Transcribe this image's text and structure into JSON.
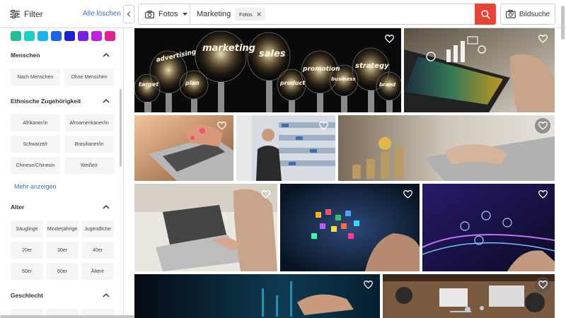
{
  "topbar": {
    "filter_label": "Filter",
    "clear_all_label": "Alle löschen",
    "type_select_value": "Fotos",
    "query_text": "Marketing",
    "chip_label": "Fotos",
    "image_search_label": "Bildsuche"
  },
  "sidebar": {
    "color_swatches": [
      "#1fbf9a",
      "#19d1c8",
      "#18b6f0",
      "#1f64e6",
      "#1b1fd8",
      "#7a1fe6",
      "#c01fe6",
      "#e61f8f"
    ],
    "people": {
      "title": "Menschen",
      "options": [
        "Nach Menschen",
        "Ohne Menschen"
      ]
    },
    "ethnicity": {
      "title": "Ethnische Zugehörigkeit",
      "options": [
        "Afrikaner/in",
        "Afroamerikaner/in",
        "Schwarze/r",
        "Brasilianer/in",
        "Chinese/Chinesin",
        "Weiße/r"
      ],
      "more_label": "Mehr anzeigen"
    },
    "age": {
      "title": "Alter",
      "options": [
        "Säuglinge",
        "Minderjährige",
        "Jugendliche",
        "20er",
        "30er",
        "40er",
        "50er",
        "60er",
        "Ältere"
      ]
    },
    "gender": {
      "title": "Geschlecht"
    }
  },
  "gallery": {
    "bulb_words": [
      "advertising",
      "marketing",
      "sales",
      "target",
      "plan",
      "product",
      "promotion",
      "business",
      "strategy",
      "brand"
    ]
  }
}
